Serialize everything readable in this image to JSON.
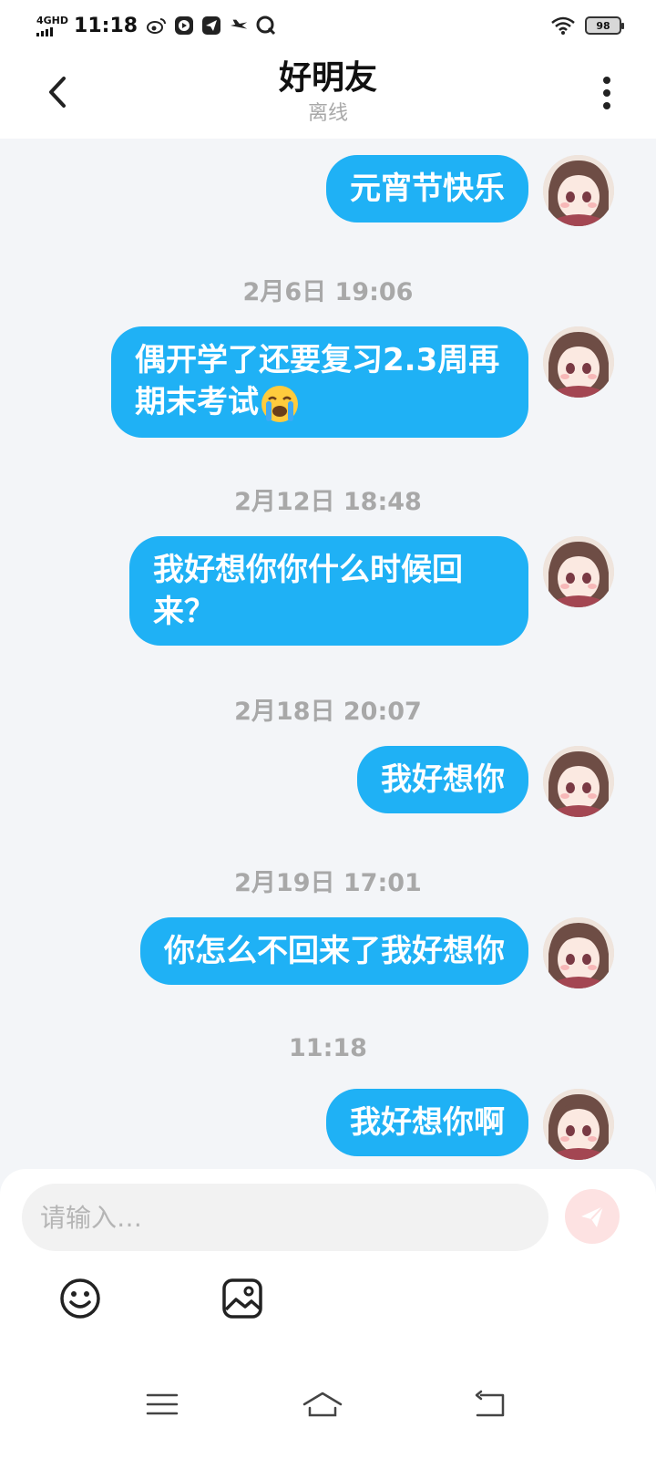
{
  "status_bar": {
    "network": "4GHD",
    "time": "11:18",
    "battery": "98",
    "icons": [
      "weibo-icon",
      "video-icon",
      "telegram-icon",
      "airplane-icon",
      "search-q-icon"
    ]
  },
  "header": {
    "title": "好明友",
    "subtitle": "离线",
    "back_icon": "chevron-left-icon",
    "more_icon": "more-vertical-icon"
  },
  "messages": [
    {
      "type": "message",
      "text": "元宵节快乐"
    },
    {
      "type": "timestamp",
      "text": "2月6日 19:06"
    },
    {
      "type": "message",
      "text": "偶开学了还要复习2.3周再期末考试",
      "emoji": "loudly-crying-face"
    },
    {
      "type": "timestamp",
      "text": "2月12日 18:48"
    },
    {
      "type": "message",
      "text": "我好想你你什么时候回来？"
    },
    {
      "type": "timestamp",
      "text": "2月18日 20:07"
    },
    {
      "type": "message",
      "text": "我好想你"
    },
    {
      "type": "timestamp",
      "text": "2月19日 17:01"
    },
    {
      "type": "message",
      "text": "你怎么不回来了我好想你"
    },
    {
      "type": "timestamp",
      "text": "11:18"
    },
    {
      "type": "message",
      "text": "我好想你啊"
    }
  ],
  "input": {
    "placeholder": "请输入…",
    "value": ""
  },
  "toolbar": {
    "emoji_icon": "smiley-icon",
    "image_icon": "image-icon",
    "send_icon": "send-icon"
  },
  "colors": {
    "bubble": "#1fb1f5",
    "background": "#f3f5f8",
    "timestamp": "#a8a8a8",
    "send_button": "#fde2e2"
  },
  "nav_bar": {
    "icons": [
      "menu-icon",
      "home-icon",
      "back-icon"
    ]
  }
}
